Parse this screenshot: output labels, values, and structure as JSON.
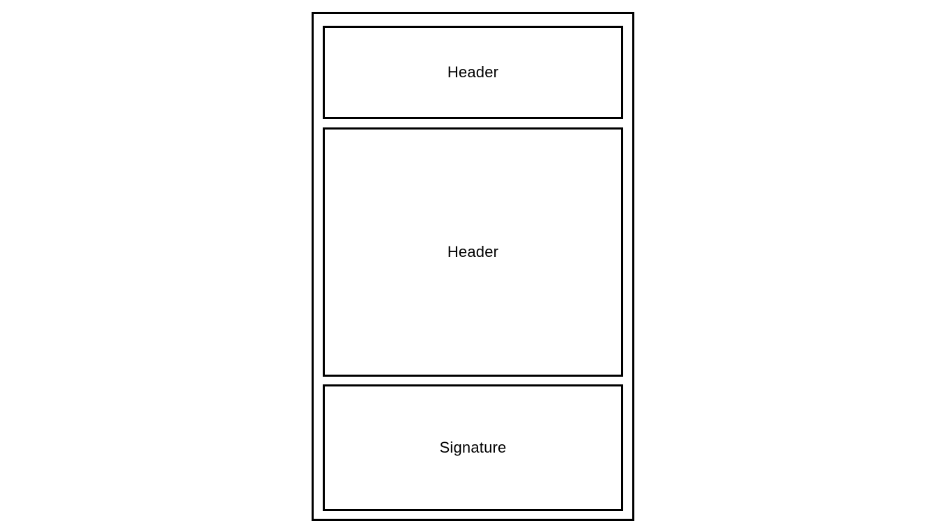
{
  "layout": {
    "sections": [
      {
        "id": "header-top",
        "label": "Header"
      },
      {
        "id": "header-main",
        "label": "Header"
      },
      {
        "id": "signature",
        "label": "Signature"
      }
    ]
  },
  "colors": {
    "background": "#ffffff",
    "stroke": "#000000",
    "text": "#000000"
  }
}
